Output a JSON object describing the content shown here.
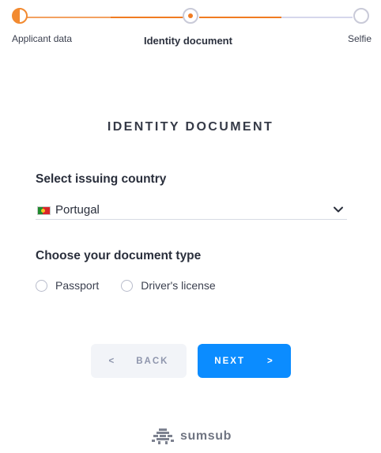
{
  "stepper": {
    "steps": [
      {
        "label": "Applicant data",
        "state": "partial"
      },
      {
        "label": "Identity document",
        "state": "current"
      },
      {
        "label": "Selfie",
        "state": "pending"
      }
    ]
  },
  "page_title": "IDENTITY DOCUMENT",
  "country": {
    "label": "Select issuing country",
    "value": "Portugal",
    "flag": "portugal-flag"
  },
  "document_type": {
    "label": "Choose your document type",
    "options": [
      "Passport",
      "Driver's license"
    ]
  },
  "buttons": {
    "back": {
      "arrow": "<",
      "label": "BACK"
    },
    "next": {
      "arrow": ">",
      "label": "NEXT"
    }
  },
  "brand": {
    "name": "sumsub"
  },
  "colors": {
    "accent": "#f07c22",
    "primary_button": "#0b8cff",
    "secondary_button": "#f2f4f8"
  }
}
